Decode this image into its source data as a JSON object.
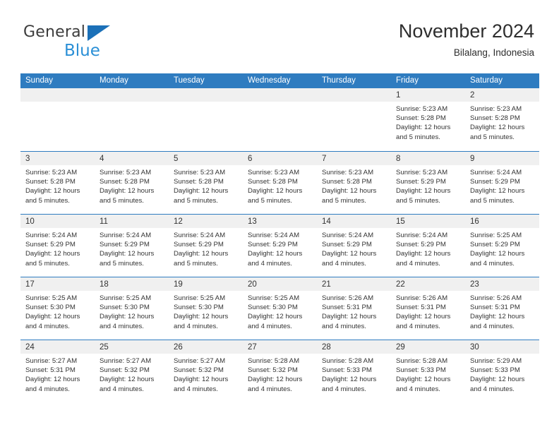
{
  "logo": {
    "text_primary": "General",
    "text_secondary": "Blue",
    "triangle_color": "#1b70b8",
    "secondary_color": "#2a8fd6"
  },
  "header": {
    "title": "November 2024",
    "subtitle": "Bilalang, Indonesia"
  },
  "theme": {
    "header_bg": "#2f7cc0",
    "header_text": "#ffffff",
    "day_band_bg": "#f0f0f0",
    "cell_bg": "#ffffff",
    "text": "#333333"
  },
  "weekdays": [
    "Sunday",
    "Monday",
    "Tuesday",
    "Wednesday",
    "Thursday",
    "Friday",
    "Saturday"
  ],
  "weeks": [
    [
      {
        "day": "",
        "sunrise": "",
        "sunset": "",
        "daylight1": "",
        "daylight2": ""
      },
      {
        "day": "",
        "sunrise": "",
        "sunset": "",
        "daylight1": "",
        "daylight2": ""
      },
      {
        "day": "",
        "sunrise": "",
        "sunset": "",
        "daylight1": "",
        "daylight2": ""
      },
      {
        "day": "",
        "sunrise": "",
        "sunset": "",
        "daylight1": "",
        "daylight2": ""
      },
      {
        "day": "",
        "sunrise": "",
        "sunset": "",
        "daylight1": "",
        "daylight2": ""
      },
      {
        "day": "1",
        "sunrise": "Sunrise: 5:23 AM",
        "sunset": "Sunset: 5:28 PM",
        "daylight1": "Daylight: 12 hours",
        "daylight2": "and 5 minutes."
      },
      {
        "day": "2",
        "sunrise": "Sunrise: 5:23 AM",
        "sunset": "Sunset: 5:28 PM",
        "daylight1": "Daylight: 12 hours",
        "daylight2": "and 5 minutes."
      }
    ],
    [
      {
        "day": "3",
        "sunrise": "Sunrise: 5:23 AM",
        "sunset": "Sunset: 5:28 PM",
        "daylight1": "Daylight: 12 hours",
        "daylight2": "and 5 minutes."
      },
      {
        "day": "4",
        "sunrise": "Sunrise: 5:23 AM",
        "sunset": "Sunset: 5:28 PM",
        "daylight1": "Daylight: 12 hours",
        "daylight2": "and 5 minutes."
      },
      {
        "day": "5",
        "sunrise": "Sunrise: 5:23 AM",
        "sunset": "Sunset: 5:28 PM",
        "daylight1": "Daylight: 12 hours",
        "daylight2": "and 5 minutes."
      },
      {
        "day": "6",
        "sunrise": "Sunrise: 5:23 AM",
        "sunset": "Sunset: 5:28 PM",
        "daylight1": "Daylight: 12 hours",
        "daylight2": "and 5 minutes."
      },
      {
        "day": "7",
        "sunrise": "Sunrise: 5:23 AM",
        "sunset": "Sunset: 5:28 PM",
        "daylight1": "Daylight: 12 hours",
        "daylight2": "and 5 minutes."
      },
      {
        "day": "8",
        "sunrise": "Sunrise: 5:23 AM",
        "sunset": "Sunset: 5:29 PM",
        "daylight1": "Daylight: 12 hours",
        "daylight2": "and 5 minutes."
      },
      {
        "day": "9",
        "sunrise": "Sunrise: 5:24 AM",
        "sunset": "Sunset: 5:29 PM",
        "daylight1": "Daylight: 12 hours",
        "daylight2": "and 5 minutes."
      }
    ],
    [
      {
        "day": "10",
        "sunrise": "Sunrise: 5:24 AM",
        "sunset": "Sunset: 5:29 PM",
        "daylight1": "Daylight: 12 hours",
        "daylight2": "and 5 minutes."
      },
      {
        "day": "11",
        "sunrise": "Sunrise: 5:24 AM",
        "sunset": "Sunset: 5:29 PM",
        "daylight1": "Daylight: 12 hours",
        "daylight2": "and 5 minutes."
      },
      {
        "day": "12",
        "sunrise": "Sunrise: 5:24 AM",
        "sunset": "Sunset: 5:29 PM",
        "daylight1": "Daylight: 12 hours",
        "daylight2": "and 5 minutes."
      },
      {
        "day": "13",
        "sunrise": "Sunrise: 5:24 AM",
        "sunset": "Sunset: 5:29 PM",
        "daylight1": "Daylight: 12 hours",
        "daylight2": "and 4 minutes."
      },
      {
        "day": "14",
        "sunrise": "Sunrise: 5:24 AM",
        "sunset": "Sunset: 5:29 PM",
        "daylight1": "Daylight: 12 hours",
        "daylight2": "and 4 minutes."
      },
      {
        "day": "15",
        "sunrise": "Sunrise: 5:24 AM",
        "sunset": "Sunset: 5:29 PM",
        "daylight1": "Daylight: 12 hours",
        "daylight2": "and 4 minutes."
      },
      {
        "day": "16",
        "sunrise": "Sunrise: 5:25 AM",
        "sunset": "Sunset: 5:29 PM",
        "daylight1": "Daylight: 12 hours",
        "daylight2": "and 4 minutes."
      }
    ],
    [
      {
        "day": "17",
        "sunrise": "Sunrise: 5:25 AM",
        "sunset": "Sunset: 5:30 PM",
        "daylight1": "Daylight: 12 hours",
        "daylight2": "and 4 minutes."
      },
      {
        "day": "18",
        "sunrise": "Sunrise: 5:25 AM",
        "sunset": "Sunset: 5:30 PM",
        "daylight1": "Daylight: 12 hours",
        "daylight2": "and 4 minutes."
      },
      {
        "day": "19",
        "sunrise": "Sunrise: 5:25 AM",
        "sunset": "Sunset: 5:30 PM",
        "daylight1": "Daylight: 12 hours",
        "daylight2": "and 4 minutes."
      },
      {
        "day": "20",
        "sunrise": "Sunrise: 5:25 AM",
        "sunset": "Sunset: 5:30 PM",
        "daylight1": "Daylight: 12 hours",
        "daylight2": "and 4 minutes."
      },
      {
        "day": "21",
        "sunrise": "Sunrise: 5:26 AM",
        "sunset": "Sunset: 5:31 PM",
        "daylight1": "Daylight: 12 hours",
        "daylight2": "and 4 minutes."
      },
      {
        "day": "22",
        "sunrise": "Sunrise: 5:26 AM",
        "sunset": "Sunset: 5:31 PM",
        "daylight1": "Daylight: 12 hours",
        "daylight2": "and 4 minutes."
      },
      {
        "day": "23",
        "sunrise": "Sunrise: 5:26 AM",
        "sunset": "Sunset: 5:31 PM",
        "daylight1": "Daylight: 12 hours",
        "daylight2": "and 4 minutes."
      }
    ],
    [
      {
        "day": "24",
        "sunrise": "Sunrise: 5:27 AM",
        "sunset": "Sunset: 5:31 PM",
        "daylight1": "Daylight: 12 hours",
        "daylight2": "and 4 minutes."
      },
      {
        "day": "25",
        "sunrise": "Sunrise: 5:27 AM",
        "sunset": "Sunset: 5:32 PM",
        "daylight1": "Daylight: 12 hours",
        "daylight2": "and 4 minutes."
      },
      {
        "day": "26",
        "sunrise": "Sunrise: 5:27 AM",
        "sunset": "Sunset: 5:32 PM",
        "daylight1": "Daylight: 12 hours",
        "daylight2": "and 4 minutes."
      },
      {
        "day": "27",
        "sunrise": "Sunrise: 5:28 AM",
        "sunset": "Sunset: 5:32 PM",
        "daylight1": "Daylight: 12 hours",
        "daylight2": "and 4 minutes."
      },
      {
        "day": "28",
        "sunrise": "Sunrise: 5:28 AM",
        "sunset": "Sunset: 5:33 PM",
        "daylight1": "Daylight: 12 hours",
        "daylight2": "and 4 minutes."
      },
      {
        "day": "29",
        "sunrise": "Sunrise: 5:28 AM",
        "sunset": "Sunset: 5:33 PM",
        "daylight1": "Daylight: 12 hours",
        "daylight2": "and 4 minutes."
      },
      {
        "day": "30",
        "sunrise": "Sunrise: 5:29 AM",
        "sunset": "Sunset: 5:33 PM",
        "daylight1": "Daylight: 12 hours",
        "daylight2": "and 4 minutes."
      }
    ]
  ]
}
